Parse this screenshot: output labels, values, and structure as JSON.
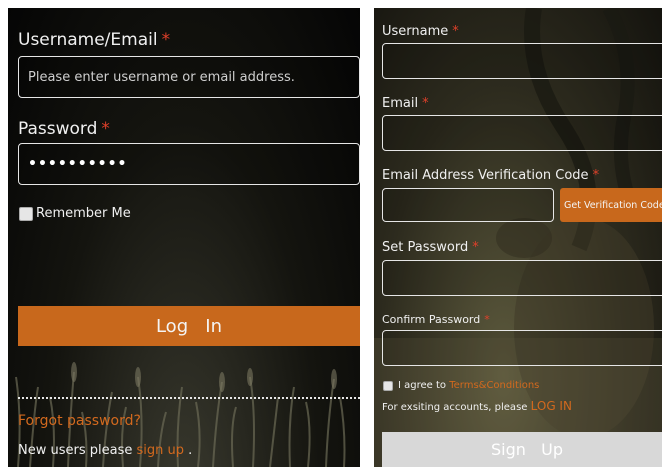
{
  "colors": {
    "accent": "#c8681c",
    "required_star": "#e0402a",
    "link": "#d2691e",
    "signup_button_bg": "#d8d8d8"
  },
  "login": {
    "username_label": "Username/Email",
    "username_placeholder": "Please enter username or email address.",
    "password_label": "Password",
    "password_value": "••••••••••",
    "remember_me_label": "Remember Me",
    "remember_me_checked": false,
    "login_button": "Log   In",
    "forgot_password_link": "Forgot password?",
    "new_users_text": "New users please ",
    "sign_up_link": "sign up",
    "new_users_suffix": " ."
  },
  "signup": {
    "username_label": "Username",
    "email_label": "Email",
    "verification_label": "Email Address Verification Code",
    "get_code_button": "Get Verification Code",
    "set_password_label": "Set Password",
    "confirm_password_label": "Confirm Password",
    "agree_text": "I agree to ",
    "terms_link": "Terms&Conditions",
    "agree_checked": false,
    "existing_text": "For exsiting accounts, please ",
    "login_link": "LOG IN",
    "signup_button": "Sign   Up"
  },
  "required_marker": "*"
}
